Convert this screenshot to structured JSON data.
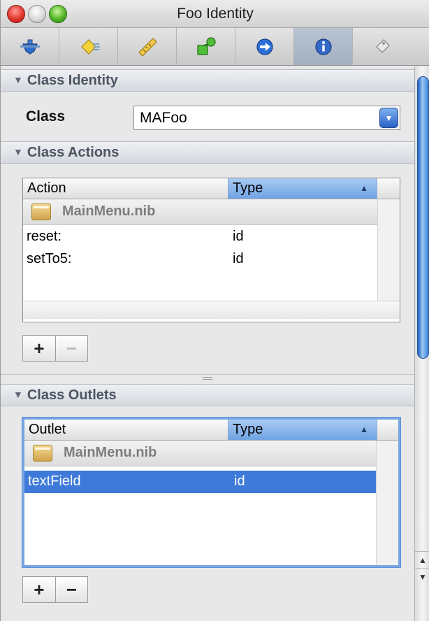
{
  "window": {
    "title": "Foo Identity"
  },
  "toolbar": {
    "tabs": [
      {
        "icon": "attributes-icon"
      },
      {
        "icon": "effects-icon"
      },
      {
        "icon": "size-ruler-icon"
      },
      {
        "icon": "connections-icon"
      },
      {
        "icon": "bindings-arrow-icon"
      },
      {
        "icon": "identity-info-icon",
        "active": true
      },
      {
        "icon": "tag-icon"
      }
    ]
  },
  "class_identity": {
    "header": "Class Identity",
    "class_label": "Class",
    "class_value": "MAFoo"
  },
  "class_actions": {
    "header": "Class Actions",
    "columns": [
      "Action",
      "Type"
    ],
    "group": "MainMenu.nib",
    "rows": [
      {
        "name": "reset:",
        "type": "id"
      },
      {
        "name": "setTo5:",
        "type": "id"
      }
    ],
    "add_label": "+",
    "remove_label": "−"
  },
  "class_outlets": {
    "header": "Class Outlets",
    "columns": [
      "Outlet",
      "Type"
    ],
    "group": "MainMenu.nib",
    "rows": [
      {
        "name": "textField",
        "type": "id",
        "selected": true
      }
    ],
    "add_label": "+",
    "remove_label": "−"
  },
  "colors": {
    "selection": "#3e7ad9",
    "sorted_header": "#6fa3e3",
    "scroll_thumb": "#3c83d9"
  }
}
